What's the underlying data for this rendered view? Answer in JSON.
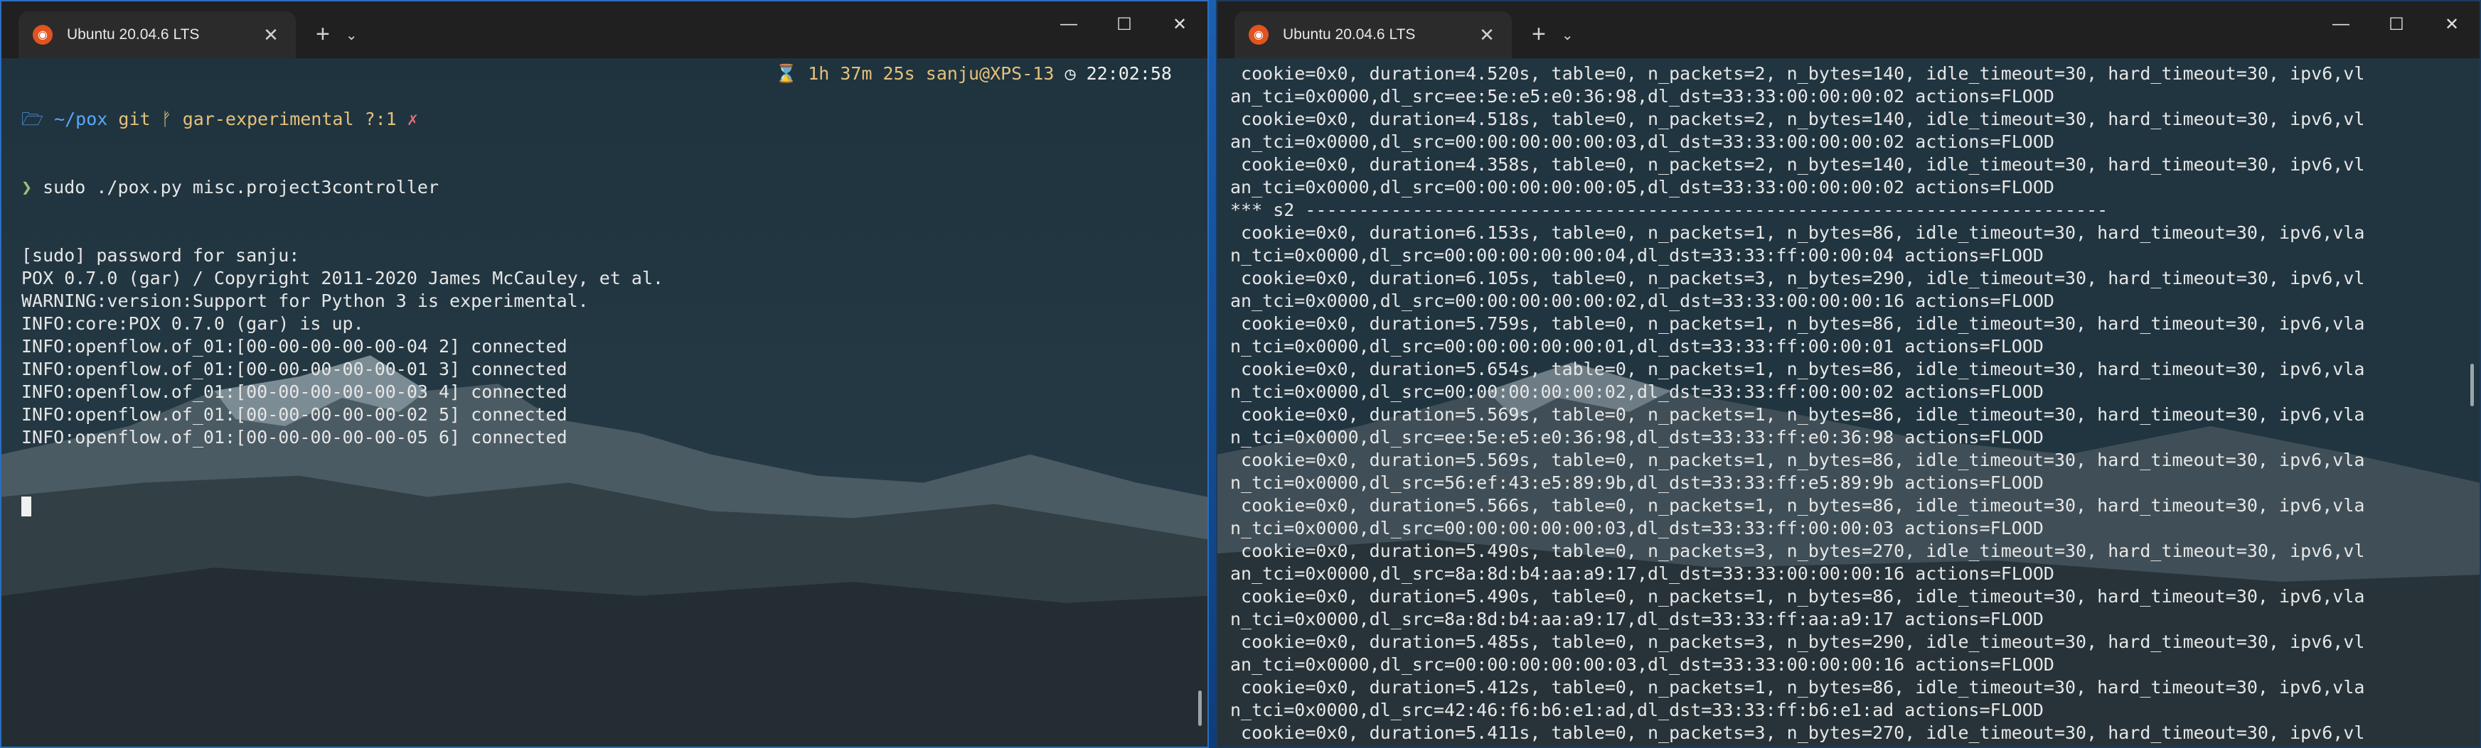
{
  "left_window": {
    "tab_title": "Ubuntu 20.04.6 LTS",
    "prompt": {
      "path": "~/pox",
      "git_label": "git",
      "branch": "gar-experimental",
      "status": "?:1",
      "status_mark": "✗",
      "elapsed": "1h 37m 25s",
      "user_host": "sanju@XPS-13",
      "clock": "22:02:58"
    },
    "command": "sudo ./pox.py misc.project3controller",
    "output": [
      "[sudo] password for sanju:",
      "POX 0.7.0 (gar) / Copyright 2011-2020 James McCauley, et al.",
      "WARNING:version:Support for Python 3 is experimental.",
      "INFO:core:POX 0.7.0 (gar) is up.",
      "INFO:openflow.of_01:[00-00-00-00-00-04 2] connected",
      "INFO:openflow.of_01:[00-00-00-00-00-01 3] connected",
      "INFO:openflow.of_01:[00-00-00-00-00-03 4] connected",
      "INFO:openflow.of_01:[00-00-00-00-00-02 5] connected",
      "INFO:openflow.of_01:[00-00-00-00-00-05 6] connected"
    ]
  },
  "right_window": {
    "tab_title": "Ubuntu 20.04.6 LTS",
    "lines": [
      " cookie=0x0, duration=4.520s, table=0, n_packets=2, n_bytes=140, idle_timeout=30, hard_timeout=30, ipv6,vl",
      "an_tci=0x0000,dl_src=ee:5e:e5:e0:36:98,dl_dst=33:33:00:00:00:02 actions=FLOOD",
      " cookie=0x0, duration=4.518s, table=0, n_packets=2, n_bytes=140, idle_timeout=30, hard_timeout=30, ipv6,vl",
      "an_tci=0x0000,dl_src=00:00:00:00:00:03,dl_dst=33:33:00:00:00:02 actions=FLOOD",
      " cookie=0x0, duration=4.358s, table=0, n_packets=2, n_bytes=140, idle_timeout=30, hard_timeout=30, ipv6,vl",
      "an_tci=0x0000,dl_src=00:00:00:00:00:05,dl_dst=33:33:00:00:00:02 actions=FLOOD",
      "*** s2 ---------------------------------------------------------------------------",
      " cookie=0x0, duration=6.153s, table=0, n_packets=1, n_bytes=86, idle_timeout=30, hard_timeout=30, ipv6,vla",
      "n_tci=0x0000,dl_src=00:00:00:00:00:04,dl_dst=33:33:ff:00:00:04 actions=FLOOD",
      " cookie=0x0, duration=6.105s, table=0, n_packets=3, n_bytes=290, idle_timeout=30, hard_timeout=30, ipv6,vl",
      "an_tci=0x0000,dl_src=00:00:00:00:00:02,dl_dst=33:33:00:00:00:16 actions=FLOOD",
      " cookie=0x0, duration=5.759s, table=0, n_packets=1, n_bytes=86, idle_timeout=30, hard_timeout=30, ipv6,vla",
      "n_tci=0x0000,dl_src=00:00:00:00:00:01,dl_dst=33:33:ff:00:00:01 actions=FLOOD",
      " cookie=0x0, duration=5.654s, table=0, n_packets=1, n_bytes=86, idle_timeout=30, hard_timeout=30, ipv6,vla",
      "n_tci=0x0000,dl_src=00:00:00:00:00:02,dl_dst=33:33:ff:00:00:02 actions=FLOOD",
      " cookie=0x0, duration=5.569s, table=0, n_packets=1, n_bytes=86, idle_timeout=30, hard_timeout=30, ipv6,vla",
      "n_tci=0x0000,dl_src=ee:5e:e5:e0:36:98,dl_dst=33:33:ff:e0:36:98 actions=FLOOD",
      " cookie=0x0, duration=5.569s, table=0, n_packets=1, n_bytes=86, idle_timeout=30, hard_timeout=30, ipv6,vla",
      "n_tci=0x0000,dl_src=56:ef:43:e5:89:9b,dl_dst=33:33:ff:e5:89:9b actions=FLOOD",
      " cookie=0x0, duration=5.566s, table=0, n_packets=1, n_bytes=86, idle_timeout=30, hard_timeout=30, ipv6,vla",
      "n_tci=0x0000,dl_src=00:00:00:00:00:03,dl_dst=33:33:ff:00:00:03 actions=FLOOD",
      " cookie=0x0, duration=5.490s, table=0, n_packets=3, n_bytes=270, idle_timeout=30, hard_timeout=30, ipv6,vl",
      "an_tci=0x0000,dl_src=8a:8d:b4:aa:a9:17,dl_dst=33:33:00:00:00:16 actions=FLOOD",
      " cookie=0x0, duration=5.490s, table=0, n_packets=1, n_bytes=86, idle_timeout=30, hard_timeout=30, ipv6,vla",
      "n_tci=0x0000,dl_src=8a:8d:b4:aa:a9:17,dl_dst=33:33:ff:aa:a9:17 actions=FLOOD",
      " cookie=0x0, duration=5.485s, table=0, n_packets=3, n_bytes=290, idle_timeout=30, hard_timeout=30, ipv6,vl",
      "an_tci=0x0000,dl_src=00:00:00:00:00:03,dl_dst=33:33:00:00:00:16 actions=FLOOD",
      " cookie=0x0, duration=5.412s, table=0, n_packets=1, n_bytes=86, idle_timeout=30, hard_timeout=30, ipv6,vla",
      "n_tci=0x0000,dl_src=42:46:f6:b6:e1:ad,dl_dst=33:33:ff:b6:e1:ad actions=FLOOD",
      " cookie=0x0, duration=5.411s, table=0, n_packets=3, n_bytes=270, idle_timeout=30, hard_timeout=30, ipv6,vl"
    ]
  },
  "window_controls": {
    "minimize": "—",
    "maximize": "☐",
    "close": "✕"
  },
  "tab_controls": {
    "new_tab": "+",
    "dropdown": "⌄",
    "close": "✕"
  },
  "colors": {
    "accent": "#2c6ebf",
    "terminal_bg": "#263d49",
    "titlebar": "#202020"
  }
}
